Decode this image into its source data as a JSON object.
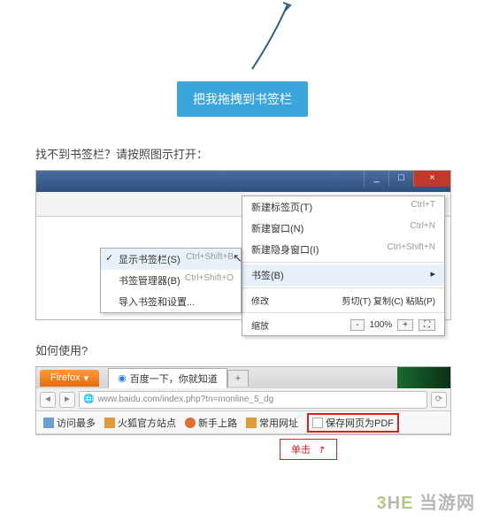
{
  "badge": "把我拖拽到书签栏",
  "instruction_find": "找不到书签栏？请按照图示打开：",
  "instruction_use": "如何使用?",
  "chrome": {
    "win": {
      "min": "_",
      "max": "□",
      "close": "×"
    },
    "star": "☆",
    "wrench": "🔧",
    "menu": {
      "new_tab": {
        "label": "新建标签页(T)",
        "sc": "Ctrl+T"
      },
      "new_win": {
        "label": "新建窗口(N)",
        "sc": "Ctrl+N"
      },
      "incog": {
        "label": "新建隐身窗口(I)",
        "sc": "Ctrl+Shift+N"
      },
      "bookmarks": {
        "label": "书签(B)",
        "arrow": "▸"
      },
      "edit": {
        "label": "修改",
        "cut": "剪切(T)",
        "copy": "复制(C)",
        "paste": "粘贴(P)"
      },
      "zoom": {
        "label": "缩放",
        "minus": "-",
        "value": "100%",
        "plus": "+",
        "full": "⛶"
      }
    },
    "submenu": {
      "show": {
        "label": "显示书签栏(S)",
        "sc": "Ctrl+Shift+B"
      },
      "mgr": {
        "label": "书签管理器(B)",
        "sc": "Ctrl+Shift+O"
      },
      "import": {
        "label": "导入书签和设置..."
      }
    }
  },
  "firefox": {
    "button": "Firefox",
    "drop": "▾",
    "tab_title": "百度一下，你就知道",
    "plus": "+",
    "nav": {
      "back": "◄",
      "fwd": "►",
      "reload": "⟳"
    },
    "url": "www.baidu.com/index.php?tn=monline_5_dg",
    "bookmarks": {
      "most": "访问最多",
      "fox": "火狐官方站点",
      "newbie": "新手上路",
      "common": "常用网址",
      "savepdf": "保存网页为PDF"
    },
    "clicklabel": "单击",
    "arrow": "↗"
  },
  "watermark": {
    "logo_letters": [
      "3",
      "H",
      "E"
    ],
    "text": "当游网"
  }
}
